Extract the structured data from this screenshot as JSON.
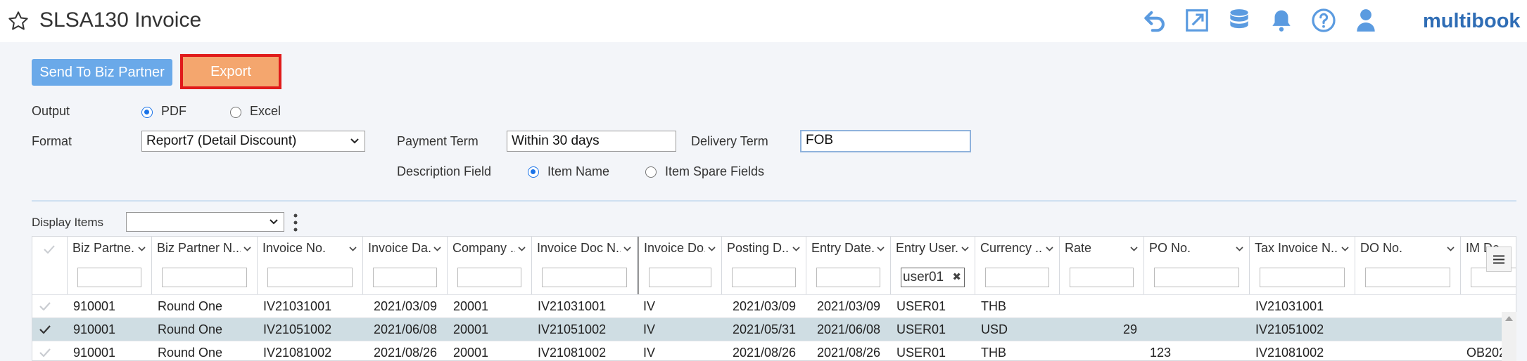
{
  "header": {
    "title": "SLSA130 Invoice",
    "logo": "multibook",
    "icons": [
      "undo-icon",
      "popout-icon",
      "database-icon",
      "bell-icon",
      "help-icon",
      "user-icon"
    ],
    "accent": "#4a90d9"
  },
  "toolbar": {
    "send_label": "Send To Biz Partner",
    "export_label": "Export"
  },
  "form": {
    "output_label": "Output",
    "output_options": [
      "PDF",
      "Excel"
    ],
    "output_selected": "PDF",
    "format_label": "Format",
    "format_value": "Report7 (Detail Discount)",
    "payment_term_label": "Payment Term",
    "payment_term_value": "Within 30 days",
    "delivery_term_label": "Delivery Term",
    "delivery_term_value": "FOB",
    "description_label": "Description Field",
    "description_options": [
      "Item Name",
      "Item Spare Fields"
    ],
    "description_selected": "Item Name"
  },
  "display": {
    "label": "Display Items",
    "value": ""
  },
  "table": {
    "columns": [
      "Biz Partne...",
      "Biz Partner N...",
      "Invoice No.",
      "Invoice Da...",
      "Company ...",
      "Invoice Doc N...",
      "Invoice Do...",
      "Posting D...",
      "Entry Date...",
      "Entry User...",
      "Currency ...",
      "Rate",
      "PO No.",
      "Tax Invoice N...",
      "DO No.",
      "IM De"
    ],
    "entry_user_filter": "user01",
    "rows": [
      {
        "cells": [
          "910001",
          "Round One",
          "IV21031001",
          "2021/03/09",
          "20001",
          "IV21031001",
          "IV",
          "2021/03/09",
          "2021/03/09",
          "USER01",
          "THB",
          "",
          "",
          "IV21031001",
          "",
          ""
        ],
        "selected": false
      },
      {
        "cells": [
          "910001",
          "Round One",
          "IV21051002",
          "2021/06/08",
          "20001",
          "IV21051002",
          "IV",
          "2021/05/31",
          "2021/06/08",
          "USER01",
          "USD",
          "29",
          "",
          "IV21051002",
          "",
          ""
        ],
        "selected": true
      },
      {
        "cells": [
          "910001",
          "Round One",
          "IV21081002",
          "2021/08/26",
          "20001",
          "IV21081002",
          "IV",
          "2021/08/26",
          "2021/08/26",
          "USER01",
          "THB",
          "",
          "123",
          "IV21081002",
          "",
          "OB202"
        ],
        "selected": false
      }
    ]
  }
}
